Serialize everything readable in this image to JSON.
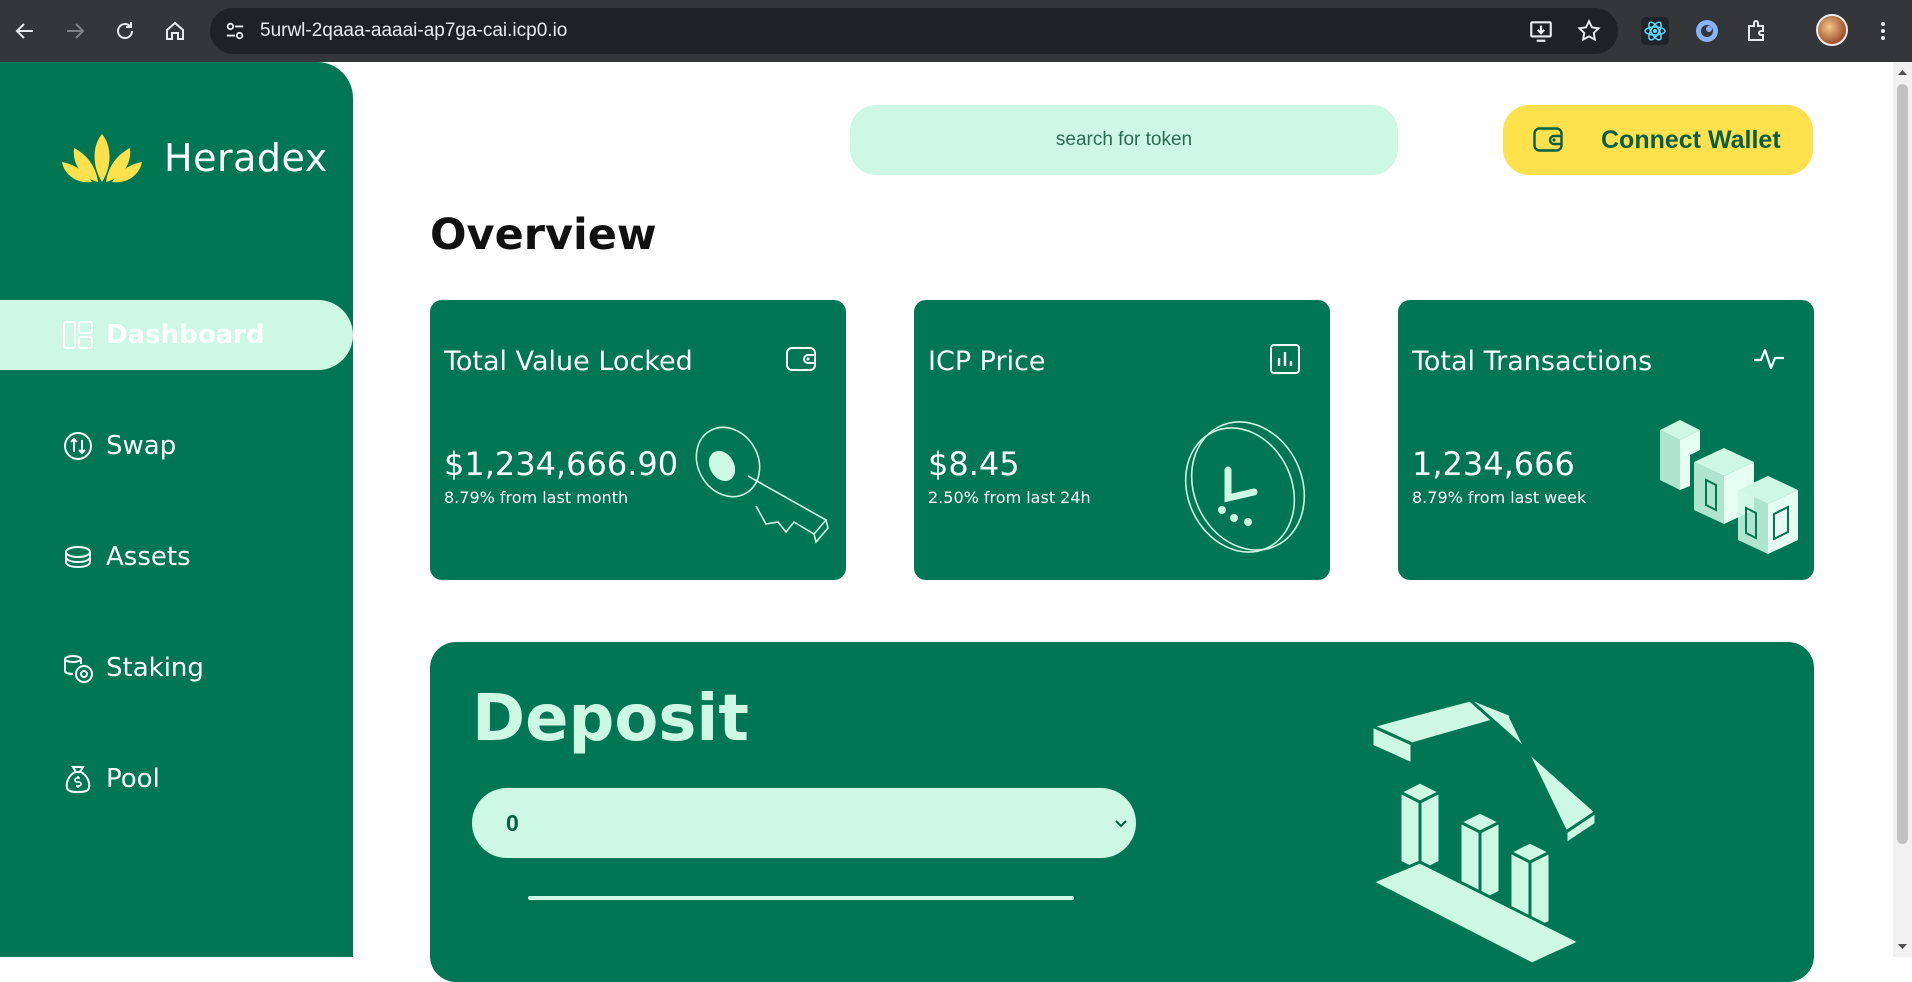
{
  "browser": {
    "url": "5urwl-2qaaa-aaaai-ap7ga-cai.icp0.io"
  },
  "brand": {
    "name": "Heradex"
  },
  "sidebar": {
    "items": [
      {
        "label": "Dashboard",
        "icon": "dashboard-icon",
        "active": true
      },
      {
        "label": "Swap",
        "icon": "swap-icon",
        "active": false
      },
      {
        "label": "Assets",
        "icon": "coins-icon",
        "active": false
      },
      {
        "label": "Staking",
        "icon": "staking-icon",
        "active": false
      },
      {
        "label": "Pool",
        "icon": "money-bag-icon",
        "active": false
      }
    ]
  },
  "header": {
    "search_placeholder": "search for token",
    "connect_label": "Connect Wallet"
  },
  "main": {
    "title": "Overview",
    "cards": [
      {
        "title": "Total Value Locked",
        "value": "$1,234,666.90",
        "sub": "8.79% from last month",
        "icon": "wallet-icon"
      },
      {
        "title": "ICP Price",
        "value": "$8.45",
        "sub": "2.50% from last 24h",
        "icon": "bar-chart-icon"
      },
      {
        "title": "Total Transactions",
        "value": "1,234,666",
        "sub": "8.79% from last week",
        "icon": "activity-icon"
      }
    ],
    "deposit": {
      "title": "Deposit",
      "selected": "0"
    }
  },
  "colors": {
    "primary": "#007652",
    "mint": "#cef8e6",
    "accent": "#ffe14e"
  }
}
